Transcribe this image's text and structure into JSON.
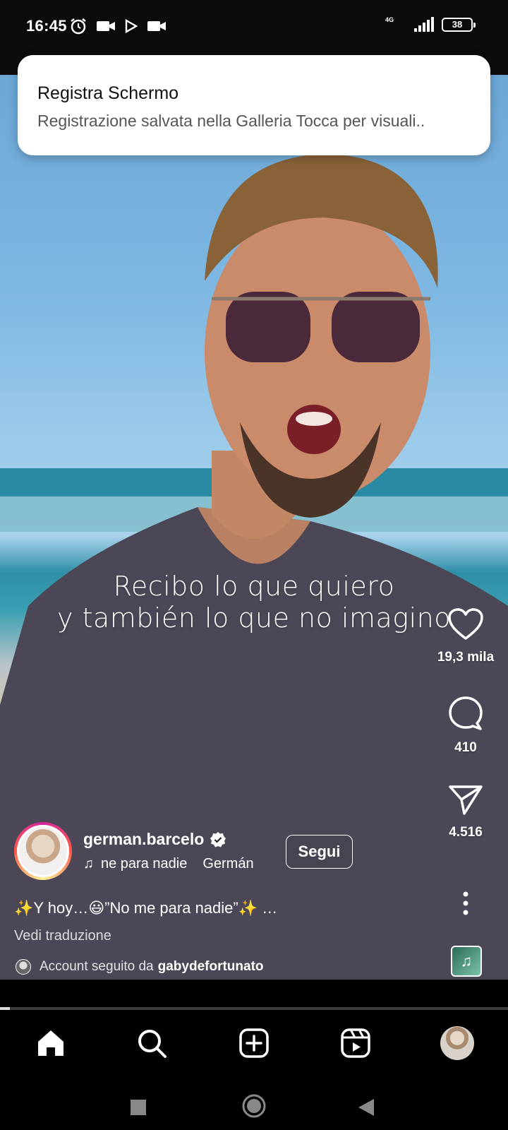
{
  "status_bar": {
    "time": "16:45",
    "network": "4G",
    "battery": "38"
  },
  "notification": {
    "title": "Registra Schermo",
    "body": "Registrazione salvata nella Galleria Tocca per visuali.."
  },
  "video": {
    "subtitle_line1": "Recibo lo que quiero",
    "subtitle_line2": "y también lo que no imagino"
  },
  "actions": {
    "likes": "19,3 mila",
    "comments": "410",
    "shares": "4.516"
  },
  "author": {
    "username": "german.barcelo",
    "verified": true,
    "music_title": "ne para nadie",
    "music_artist": "Germán",
    "follow_label": "Segui"
  },
  "caption": {
    "text": "✨Y hoy…😃”No me para nadie”✨ …",
    "translate_label": "Vedi traduzione",
    "followed_prefix": "Account seguito da",
    "followed_user": "gabydefortunato"
  },
  "progress": {
    "fraction": 0.02
  },
  "bottom_nav": {
    "items": [
      "home-icon",
      "search-icon",
      "create-icon",
      "reels-icon",
      "profile-avatar"
    ]
  },
  "colors": {
    "notification_bg": "#ffffff",
    "app_bg": "#000000",
    "text": "#ffffff"
  }
}
